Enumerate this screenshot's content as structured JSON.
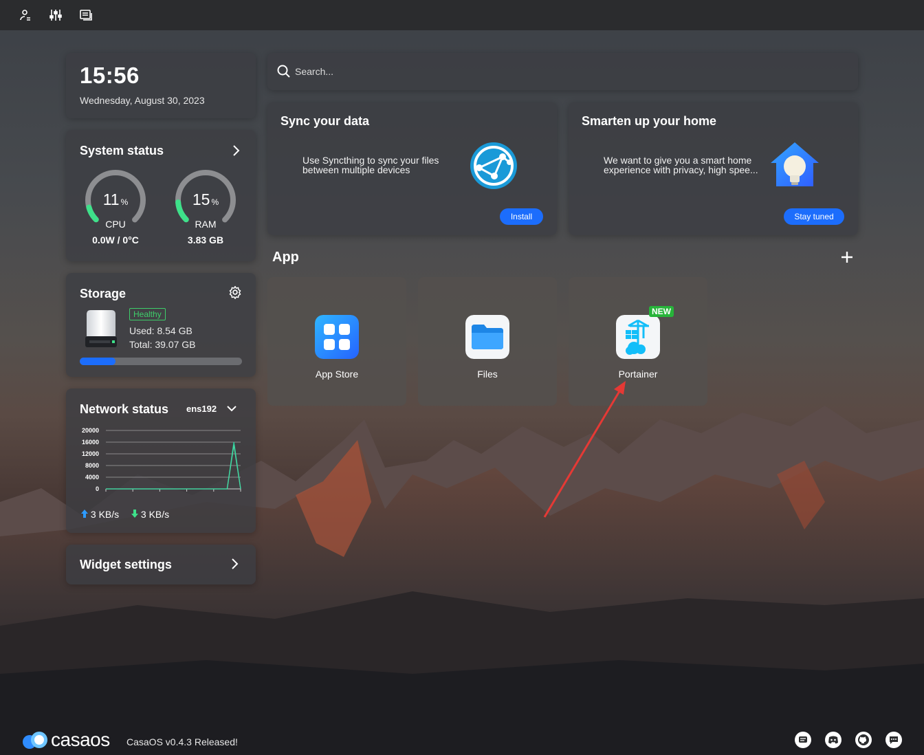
{
  "topbar": {
    "icons": [
      "account-settings-icon",
      "sliders-icon",
      "dashboard-icon"
    ]
  },
  "clock": {
    "time": "15:56",
    "date": "Wednesday, August 30, 2023"
  },
  "system_status": {
    "title": "System status",
    "cpu": {
      "percent": "11",
      "unit": "%",
      "label": "CPU",
      "sub": "0.0W / 0°C",
      "value": 0.11
    },
    "ram": {
      "percent": "15",
      "unit": "%",
      "label": "RAM",
      "sub": "3.83 GB",
      "value": 0.15
    }
  },
  "storage": {
    "title": "Storage",
    "health": "Healthy",
    "used": "Used: 8.54 GB",
    "total": "Total: 39.07 GB",
    "usage_fraction": 0.22
  },
  "network": {
    "title": "Network status",
    "interface": "ens192",
    "chart_data": {
      "type": "line",
      "y_ticks": [
        "20000",
        "16000",
        "12000",
        "8000",
        "4000",
        "0"
      ],
      "ylim": [
        0,
        20000
      ],
      "series": [
        {
          "values": [
            0,
            0,
            0,
            0,
            0,
            0,
            0,
            0,
            0,
            0,
            0,
            0,
            0,
            0,
            0,
            0,
            0,
            0,
            0,
            16000,
            0
          ]
        },
        {
          "values": [
            0,
            0,
            0,
            0,
            0,
            0,
            0,
            0,
            0,
            0,
            0,
            0,
            0,
            0,
            0,
            0,
            0,
            0,
            0,
            15000,
            0
          ]
        }
      ]
    },
    "upload": "3 KB/s",
    "download": "3 KB/s"
  },
  "widget_settings": {
    "label": "Widget settings"
  },
  "search": {
    "placeholder": "Search..."
  },
  "promos": [
    {
      "title": "Sync your data",
      "line1": "Use Syncthing to sync your files",
      "line2": "between multiple devices",
      "button": "Install"
    },
    {
      "title": "Smarten up your home",
      "line1": "We want to give you a smart home",
      "line2": "experience with privacy, high spee...",
      "button": "Stay tuned"
    }
  ],
  "apps_section": {
    "title": "App"
  },
  "apps": [
    {
      "name": "App Store",
      "icon": "app-store-icon"
    },
    {
      "name": "Files",
      "icon": "folder-icon"
    },
    {
      "name": "Portainer",
      "icon": "portainer-icon",
      "badge": "NEW"
    }
  ],
  "footer": {
    "brand": "casaos",
    "release": "CasaOS v0.4.3 Released!",
    "icons": [
      "message-icon",
      "discord-icon",
      "github-icon",
      "chat-icon"
    ]
  },
  "colors": {
    "accent": "#1c6dfc",
    "gauge_green": "#3ee18a",
    "healthy": "#3ecf6a",
    "new_badge": "#27b43a",
    "annotation_arrow": "#e53935"
  }
}
